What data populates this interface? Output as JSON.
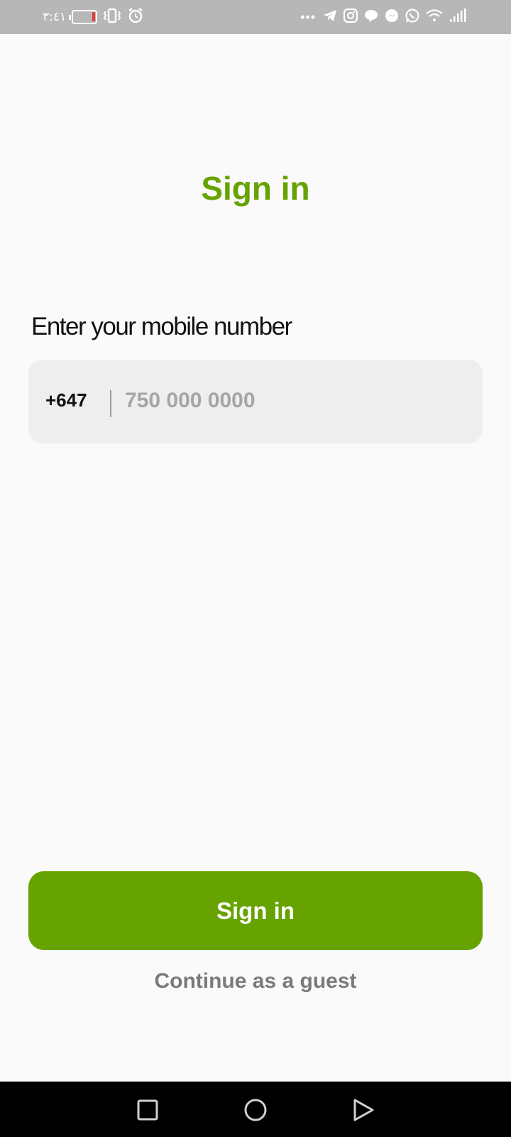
{
  "status_bar": {
    "time": "٣:٤١",
    "left_icons": [
      "battery-icon",
      "vibrate-icon",
      "alarm-icon"
    ],
    "right_icons": [
      "more-dots-icon",
      "telegram-icon",
      "instagram-icon",
      "chat-bubble-icon",
      "messenger-icon",
      "whatsapp-icon",
      "wifi-icon",
      "signal-icon"
    ],
    "more_indicator": "•••",
    "battery_level_color": "#e53935"
  },
  "page": {
    "title": "Sign in",
    "accent_color": "#67a300"
  },
  "form": {
    "label": "Enter your mobile number",
    "country_code": "+647",
    "phone": {
      "value": "",
      "placeholder": "750 000 0000"
    }
  },
  "actions": {
    "signin_label": "Sign in",
    "guest_label": "Continue as a guest"
  },
  "nav_bar": {
    "buttons": [
      "recent-apps-icon",
      "home-icon",
      "back-icon"
    ]
  }
}
